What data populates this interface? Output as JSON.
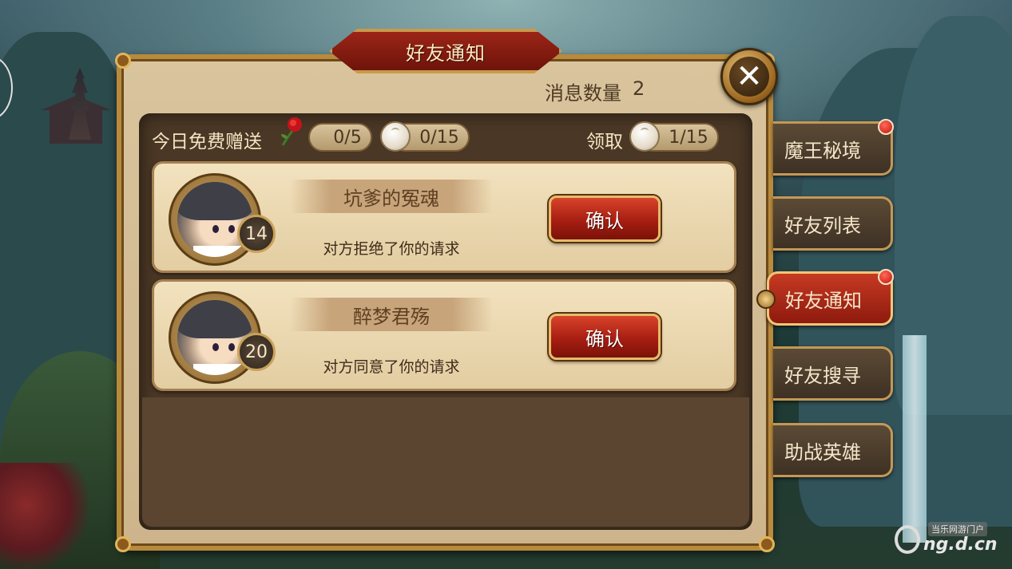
{
  "title": "好友通知",
  "message_count": {
    "label": "消息数量",
    "value": "2"
  },
  "gift_bar": {
    "free_gift_label": "今日免费赠送",
    "rose_count": "0/5",
    "bun_send_count": "0/15",
    "claim_label": "领取",
    "bun_claim_count": "1/15"
  },
  "notifications": [
    {
      "name": "坑爹的冤魂",
      "level": "14",
      "status": "对方拒绝了你的请求",
      "button": "确认"
    },
    {
      "name": "醉梦君殇",
      "level": "20",
      "status": "对方同意了你的请求",
      "button": "确认"
    }
  ],
  "side_tabs": [
    {
      "label": "魔王秘境",
      "has_dot": true,
      "active": false
    },
    {
      "label": "好友列表",
      "has_dot": false,
      "active": false
    },
    {
      "label": "好友通知",
      "has_dot": true,
      "active": true
    },
    {
      "label": "好友搜寻",
      "has_dot": false,
      "active": false
    },
    {
      "label": "助战英雄",
      "has_dot": false,
      "active": false
    }
  ],
  "watermark": {
    "top": "当乐网游门户",
    "main": "ng.d.cn"
  },
  "colors": {
    "accent_red": "#a81e12",
    "gold_border": "#c49856",
    "panel_bg": "#d9c49d"
  }
}
